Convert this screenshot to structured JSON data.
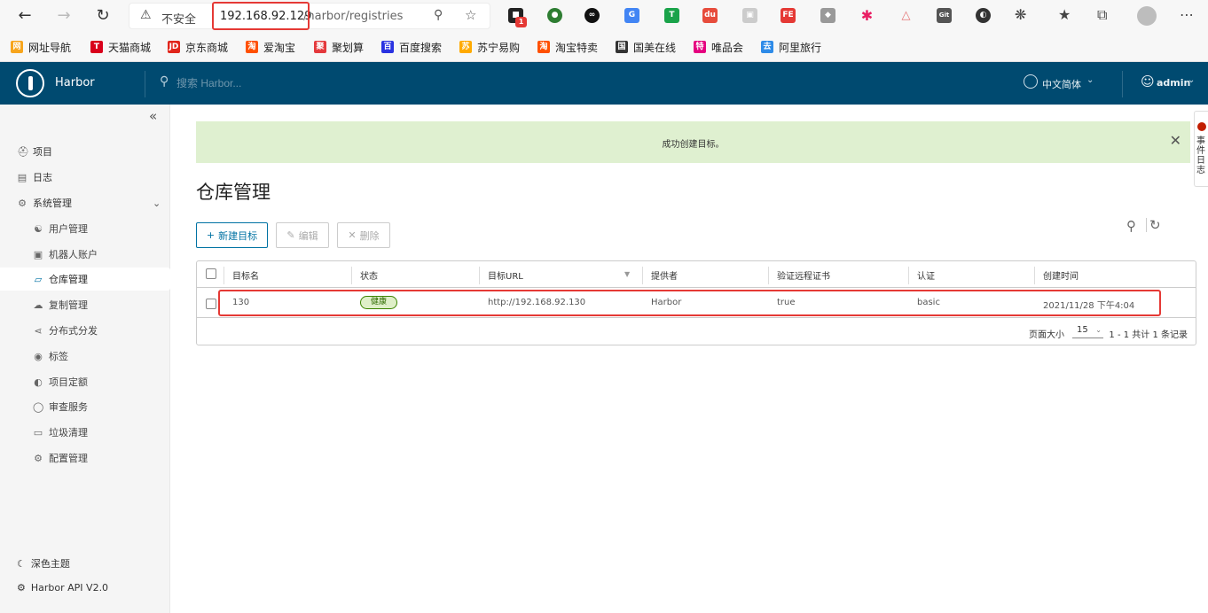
{
  "browser": {
    "insecure_label": "不安全",
    "url_host": "192.168.92.129",
    "url_path": "/harbor/registries",
    "extension_badge": "1",
    "bookmarks": [
      {
        "label": "网址导航",
        "color": "#f7a51c",
        "icon": "网"
      },
      {
        "label": "天猫商城",
        "color": "#d9001b",
        "icon": "T"
      },
      {
        "label": "京东商城",
        "color": "#e1251b",
        "icon": "JD"
      },
      {
        "label": "爱淘宝",
        "color": "#ff5000",
        "icon": "淘"
      },
      {
        "label": "聚划算",
        "color": "#e4393c",
        "icon": "聚"
      },
      {
        "label": "百度搜索",
        "color": "#2932e1",
        "icon": "百"
      },
      {
        "label": "苏宁易购",
        "color": "#ffaa00",
        "icon": "苏"
      },
      {
        "label": "淘宝特卖",
        "color": "#ff5000",
        "icon": "淘"
      },
      {
        "label": "国美在线",
        "color": "#333333",
        "icon": "国"
      },
      {
        "label": "唯品会",
        "color": "#e5007f",
        "icon": "特"
      },
      {
        "label": "阿里旅行",
        "color": "#2e8be8",
        "icon": "去"
      }
    ]
  },
  "header": {
    "app_name": "Harbor",
    "search_placeholder": "搜索 Harbor...",
    "language": "中文简体",
    "user": "admin"
  },
  "sidebar": {
    "projects": "项目",
    "logs": "日志",
    "system_admin": "系统管理",
    "sub_items": [
      "用户管理",
      "机器人账户",
      "仓库管理",
      "复制管理",
      "分布式分发",
      "标签",
      "项目定额",
      "审查服务",
      "垃圾清理",
      "配置管理"
    ],
    "theme": "深色主题",
    "api": "Harbor API V2.0"
  },
  "notice": {
    "text": "成功创建目标。"
  },
  "page": {
    "title": "仓库管理",
    "new_button": "新建目标",
    "edit_button": "编辑",
    "delete_button": "删除"
  },
  "grid": {
    "columns": [
      "目标名",
      "状态",
      "目标URL",
      "提供者",
      "验证远程证书",
      "认证",
      "创建时间"
    ],
    "rows": [
      {
        "name": "130",
        "status": "健康",
        "url": "http://192.168.92.130",
        "provider": "Harbor",
        "verify": "true",
        "auth": "basic",
        "created": "2021/11/28 下午4:04"
      }
    ],
    "page_size_label": "页面大小",
    "page_size": "15",
    "pagination": "1 - 1 共计 1 条记录"
  },
  "event_log": {
    "label": "事件日志"
  }
}
